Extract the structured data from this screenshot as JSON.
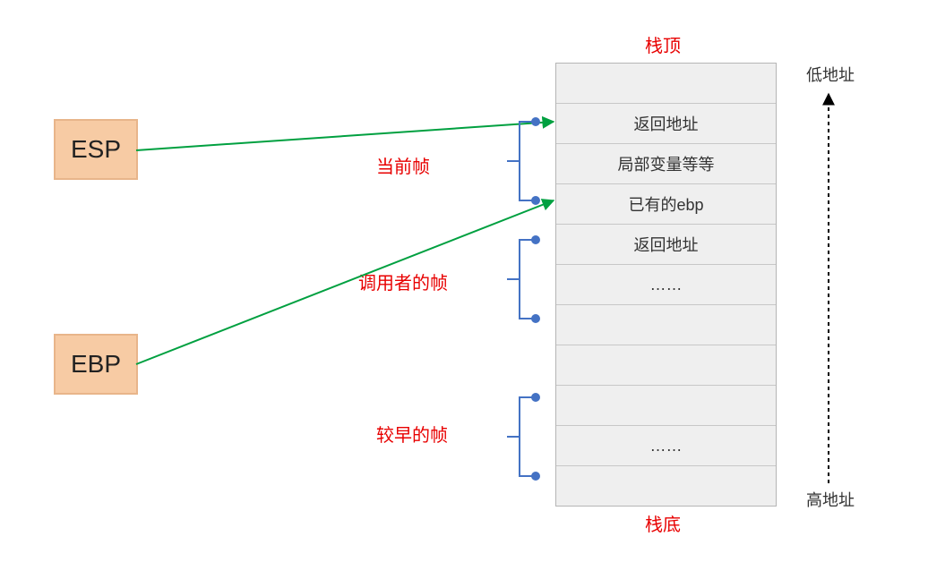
{
  "registers": {
    "esp": "ESP",
    "ebp": "EBP"
  },
  "stack_header": "栈顶",
  "stack_footer": "栈底",
  "frames": {
    "current": "当前帧",
    "caller": "调用者的帧",
    "earlier": "较早的帧"
  },
  "address": {
    "low": "低地址",
    "high": "高地址"
  },
  "stack_cells": [
    "",
    "返回地址",
    "局部变量等等",
    "已有的ebp",
    "返回地址",
    "……",
    "",
    "",
    "",
    "……",
    ""
  ]
}
